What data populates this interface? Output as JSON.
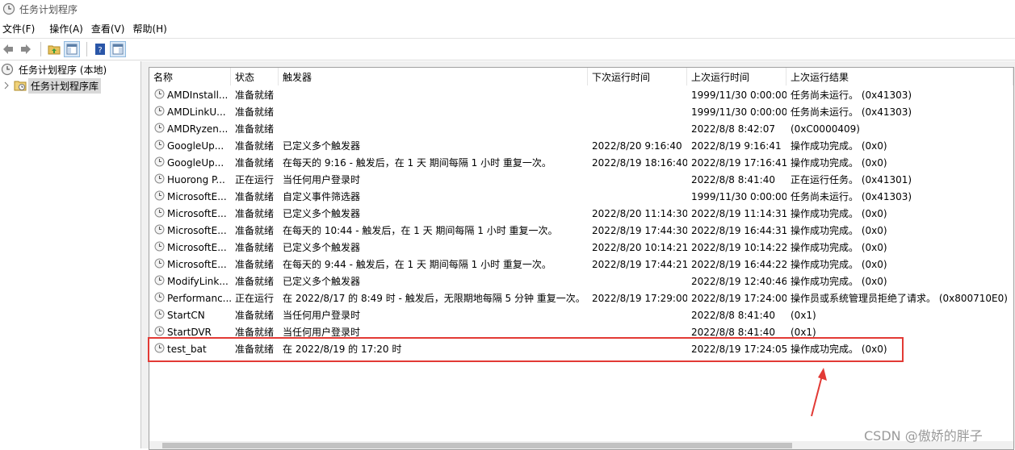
{
  "window": {
    "title": "任务计划程序"
  },
  "menu": [
    "文件(F)",
    "操作(A)",
    "查看(V)",
    "帮助(H)"
  ],
  "tree": {
    "root": "任务计划程序 (本地)",
    "child": "任务计划程序库"
  },
  "columns": [
    "名称",
    "状态",
    "触发器",
    "下次运行时间",
    "上次运行时间",
    "上次运行结果"
  ],
  "rows": [
    {
      "name": "AMDInstall...",
      "status": "准备就绪",
      "trigger": "",
      "next": "",
      "last": "1999/11/30 0:00:00",
      "result": "任务尚未运行。 (0x41303)"
    },
    {
      "name": "AMDLinkU...",
      "status": "准备就绪",
      "trigger": "",
      "next": "",
      "last": "1999/11/30 0:00:00",
      "result": "任务尚未运行。 (0x41303)"
    },
    {
      "name": "AMDRyzen...",
      "status": "准备就绪",
      "trigger": "",
      "next": "",
      "last": "2022/8/8 8:42:07",
      "result": "(0xC0000409)"
    },
    {
      "name": "GoogleUp...",
      "status": "准备就绪",
      "trigger": "已定义多个触发器",
      "next": "2022/8/20 9:16:40",
      "last": "2022/8/19 9:16:41",
      "result": "操作成功完成。 (0x0)"
    },
    {
      "name": "GoogleUp...",
      "status": "准备就绪",
      "trigger": "在每天的 9:16 - 触发后，在 1 天 期间每隔 1 小时 重复一次。",
      "next": "2022/8/19 18:16:40",
      "last": "2022/8/19 17:16:41",
      "result": "操作成功完成。 (0x0)"
    },
    {
      "name": "Huorong P...",
      "status": "正在运行",
      "trigger": "当任何用户登录时",
      "next": "",
      "last": "2022/8/8 8:41:40",
      "result": "正在运行任务。 (0x41301)"
    },
    {
      "name": "MicrosoftE...",
      "status": "准备就绪",
      "trigger": "自定义事件筛选器",
      "next": "",
      "last": "1999/11/30 0:00:00",
      "result": "任务尚未运行。 (0x41303)"
    },
    {
      "name": "MicrosoftE...",
      "status": "准备就绪",
      "trigger": "已定义多个触发器",
      "next": "2022/8/20 11:14:30",
      "last": "2022/8/19 11:14:31",
      "result": "操作成功完成。 (0x0)"
    },
    {
      "name": "MicrosoftE...",
      "status": "准备就绪",
      "trigger": "在每天的 10:44 - 触发后，在 1 天 期间每隔 1 小时 重复一次。",
      "next": "2022/8/19 17:44:30",
      "last": "2022/8/19 16:44:31",
      "result": "操作成功完成。 (0x0)"
    },
    {
      "name": "MicrosoftE...",
      "status": "准备就绪",
      "trigger": "已定义多个触发器",
      "next": "2022/8/20 10:14:21",
      "last": "2022/8/19 10:14:22",
      "result": "操作成功完成。 (0x0)"
    },
    {
      "name": "MicrosoftE...",
      "status": "准备就绪",
      "trigger": "在每天的 9:44 - 触发后，在 1 天 期间每隔 1 小时 重复一次。",
      "next": "2022/8/19 17:44:21",
      "last": "2022/8/19 16:44:22",
      "result": "操作成功完成。 (0x0)"
    },
    {
      "name": "ModifyLink...",
      "status": "准备就绪",
      "trigger": "已定义多个触发器",
      "next": "",
      "last": "2022/8/19 12:40:46",
      "result": "操作成功完成。 (0x0)"
    },
    {
      "name": "Performanc...",
      "status": "正在运行",
      "trigger": "在 2022/8/17 的 8:49 时 - 触发后，无限期地每隔 5 分钟 重复一次。",
      "next": "2022/8/19 17:29:00",
      "last": "2022/8/19 17:24:00",
      "result": "操作员或系统管理员拒绝了请求。 (0x800710E0)"
    },
    {
      "name": "StartCN",
      "status": "准备就绪",
      "trigger": "当任何用户登录时",
      "next": "",
      "last": "2022/8/8 8:41:40",
      "result": "(0x1)"
    },
    {
      "name": "StartDVR",
      "status": "准备就绪",
      "trigger": "当任何用户登录时",
      "next": "",
      "last": "2022/8/8 8:41:40",
      "result": "(0x1)"
    },
    {
      "name": "test_bat",
      "status": "准备就绪",
      "trigger": "在 2022/8/19 的 17:20 时",
      "next": "",
      "last": "2022/8/19 17:24:05",
      "result": "操作成功完成。 (0x0)"
    }
  ],
  "colors": {
    "highlight": "#e23a35",
    "selection": "#d9d9d9"
  },
  "watermark": "CSDN @傲娇的胖子"
}
